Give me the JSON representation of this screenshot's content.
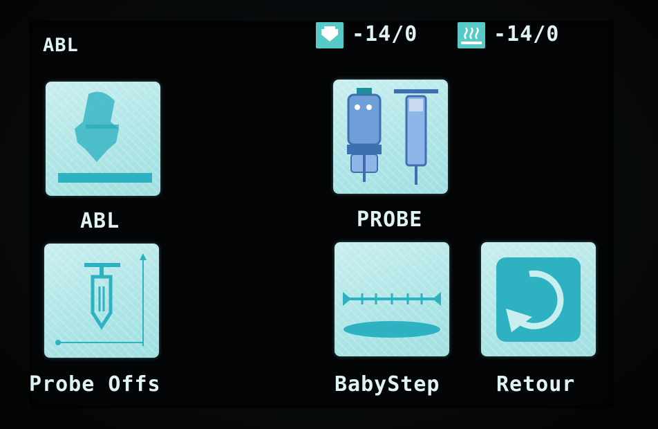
{
  "header": {
    "title": "ABL",
    "nozzle_temp": "-14/0",
    "bed_temp": "-14/0"
  },
  "buttons": {
    "abl_label": "ABL",
    "probe_label": "PROBE",
    "probe_offset_label": "Probe Offs",
    "babystep_label": "BabyStep",
    "back_label": "Retour"
  },
  "icons": {
    "nozzle": "nozzle-temp-icon",
    "bed": "bed-temp-icon",
    "abl": "auto-bed-leveling-icon",
    "probe": "bltouch-probe-icon",
    "probe_offset": "probe-offset-icon",
    "babystep": "babystep-icon",
    "back": "return-arrow-icon"
  },
  "colors": {
    "accent": "#2bb3c0",
    "tile": "#b3e7e8",
    "text": "#dff3f4",
    "background": "#030506"
  }
}
